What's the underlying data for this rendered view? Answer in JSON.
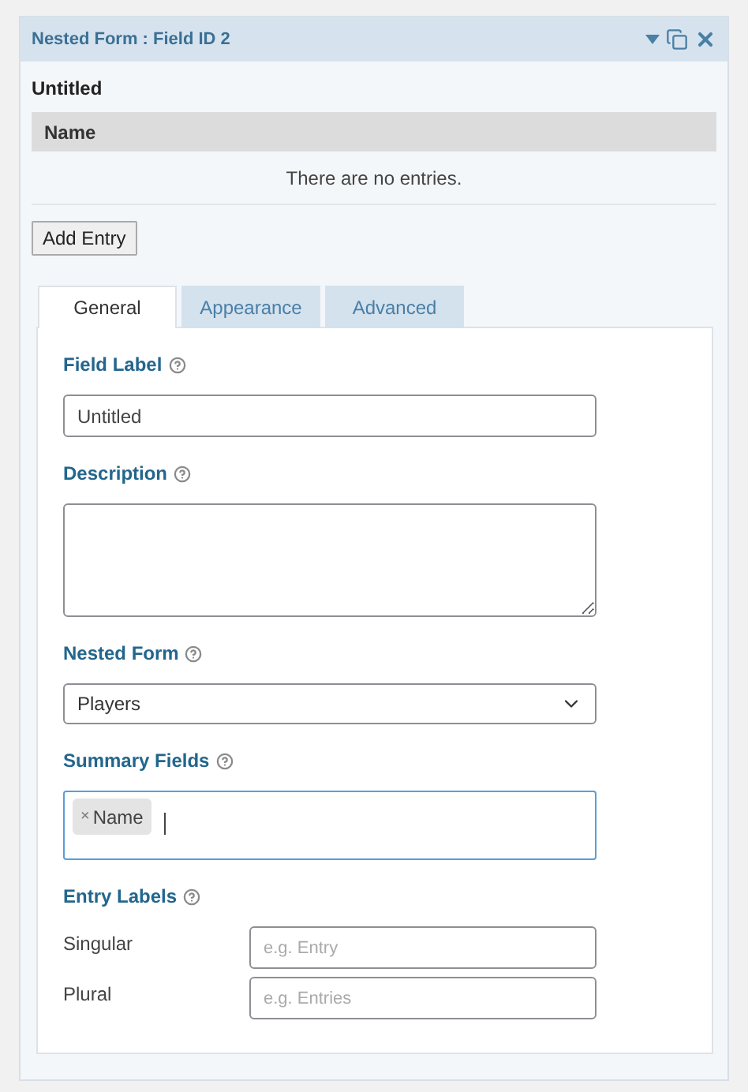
{
  "panel": {
    "title": "Nested Form : Field ID 2"
  },
  "field_preview": {
    "label": "Untitled",
    "columns": [
      "Name"
    ],
    "empty_message": "There are no entries.",
    "add_button": "Add Entry"
  },
  "tabs": [
    {
      "label": "General",
      "selected": true
    },
    {
      "label": "Appearance",
      "selected": false
    },
    {
      "label": "Advanced",
      "selected": false
    }
  ],
  "settings": [
    {
      "kind": "text",
      "label": "Field Label",
      "value": "Untitled"
    },
    {
      "kind": "textarea",
      "label": "Description"
    },
    {
      "kind": "select",
      "label": "Nested Form",
      "value": "Players"
    },
    {
      "kind": "tags",
      "label": "Summary Fields",
      "tags": [
        {
          "remove": "×",
          "label": "Name"
        }
      ],
      "focused": true
    },
    {
      "kind": "pairs",
      "label": "Entry Labels",
      "rows": [
        {
          "label": "Singular",
          "placeholder": "e.g. Entry"
        },
        {
          "label": "Plural",
          "placeholder": "e.g. Entries"
        }
      ]
    }
  ]
}
